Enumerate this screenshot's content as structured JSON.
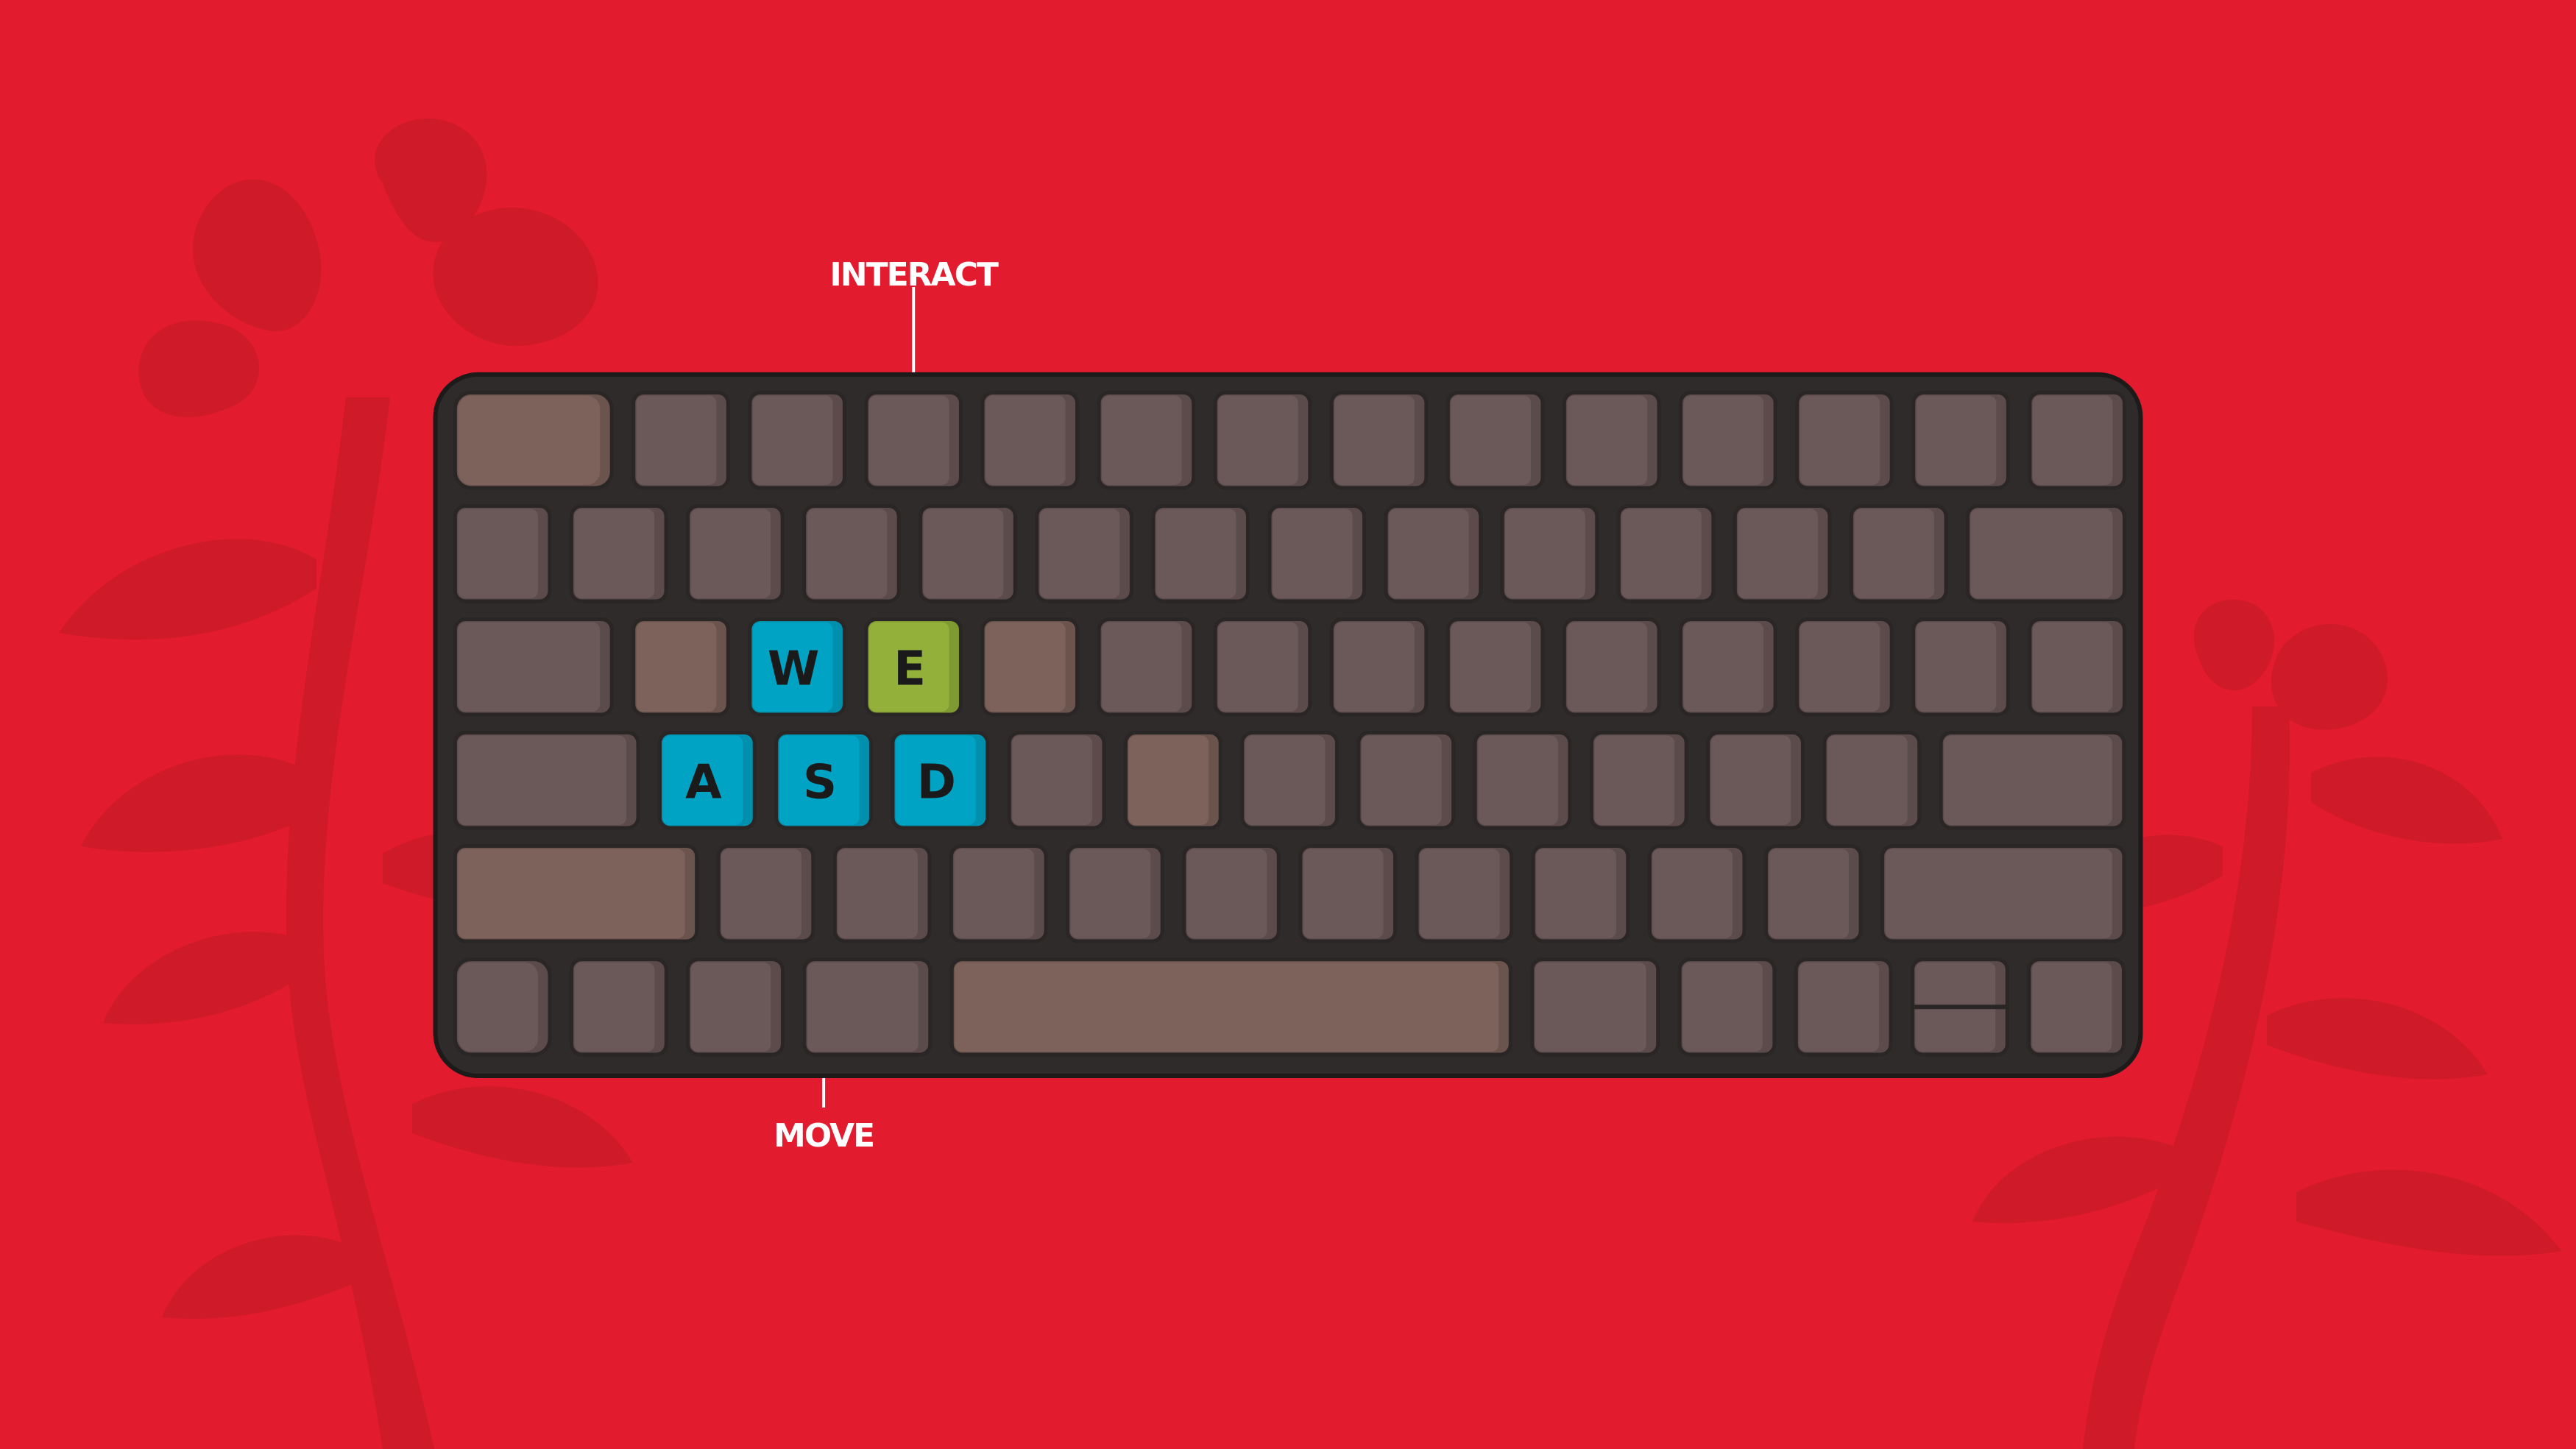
{
  "colors": {
    "background": "#e31b2e",
    "flower_silhouette": "#cf1a29",
    "keyboard_body": "#2f2b2b",
    "key_gray": "#6b5959",
    "key_gray_side": "#5c4b4b",
    "key_brown": "#7c625b",
    "key_brown_side": "#6c544e",
    "key_blue": "#00a3c4",
    "key_blue_side": "#0090ad",
    "key_green": "#93b13a",
    "key_green_side": "#7f9a30",
    "key_outline": "#2b2626",
    "key_text": "#1a1a1a",
    "label_text": "#ffffff"
  },
  "labels": {
    "interact": "INTERACT",
    "move": "MOVE"
  },
  "keys": {
    "w": "W",
    "e": "E",
    "a": "A",
    "s": "S",
    "d": "D"
  }
}
